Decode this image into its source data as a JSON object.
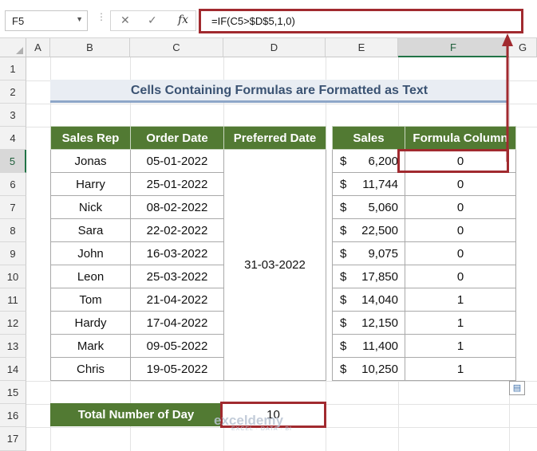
{
  "formula_bar": {
    "name_box": "F5",
    "cancel_glyph": "✕",
    "enter_glyph": "✓",
    "fx_glyph": "fx",
    "formula": "=IF(C5>$D$5,1,0)"
  },
  "columns": [
    "A",
    "B",
    "C",
    "D",
    "E",
    "F",
    "G"
  ],
  "rows": [
    "1",
    "2",
    "3",
    "4",
    "5",
    "6",
    "7",
    "8",
    "9",
    "10",
    "11",
    "12",
    "13",
    "14",
    "15",
    "16",
    "17"
  ],
  "sheet": {
    "title": "Cells Containing Formulas are Formatted as Text",
    "headers": {
      "sales_rep": "Sales Rep",
      "order_date": "Order Date",
      "preferred_date": "Preferred Date",
      "sales": "Sales",
      "formula_column": "Formula Column"
    },
    "preferred_date_value": "31-03-2022",
    "currency": "$",
    "records": [
      {
        "rep": "Jonas",
        "date": "05-01-2022",
        "sales": "6,200",
        "formula": "0"
      },
      {
        "rep": "Harry",
        "date": "25-01-2022",
        "sales": "11,744",
        "formula": "0"
      },
      {
        "rep": "Nick",
        "date": "08-02-2022",
        "sales": "5,060",
        "formula": "0"
      },
      {
        "rep": "Sara",
        "date": "22-02-2022",
        "sales": "22,500",
        "formula": "0"
      },
      {
        "rep": "John",
        "date": "16-03-2022",
        "sales": "9,075",
        "formula": "0"
      },
      {
        "rep": "Leon",
        "date": "25-03-2022",
        "sales": "17,850",
        "formula": "0"
      },
      {
        "rep": "Tom",
        "date": "21-04-2022",
        "sales": "14,040",
        "formula": "1"
      },
      {
        "rep": "Hardy",
        "date": "17-04-2022",
        "sales": "12,150",
        "formula": "1"
      },
      {
        "rep": "Mark",
        "date": "09-05-2022",
        "sales": "11,400",
        "formula": "1"
      },
      {
        "rep": "Chris",
        "date": "19-05-2022",
        "sales": "10,250",
        "formula": "1"
      }
    ],
    "total_label": "Total Number of Day",
    "total_value": "10"
  },
  "watermark": {
    "brand": "exceldemy",
    "tagline": "EXCEL · DATA · BI"
  },
  "colors": {
    "header_green": "#527a33",
    "highlight_red": "#a12a2f",
    "title_text": "#3a5272"
  }
}
